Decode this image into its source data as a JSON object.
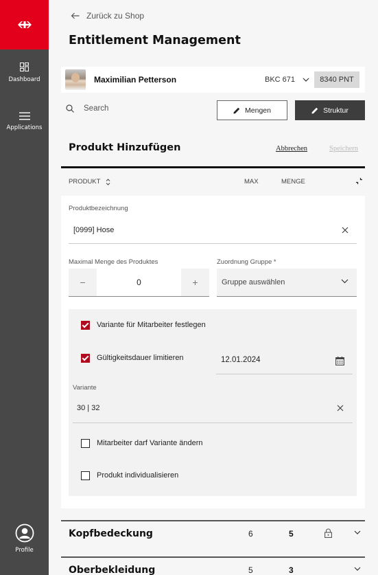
{
  "sidebar": {
    "logo": "sbb-logo-icon",
    "items": [
      {
        "label": "Dashboard",
        "icon": "dashboard-icon"
      },
      {
        "label": "Applications",
        "icon": "menu-icon"
      }
    ],
    "profile": {
      "label": "Profile",
      "icon": "profile-icon"
    }
  },
  "header": {
    "back_label": "Zurück zu Shop",
    "title": "Entitlement Management"
  },
  "user": {
    "name": "Maximilian Petterson",
    "account": "BKC 671",
    "points": "8340 PNT"
  },
  "toolbar": {
    "search_placeholder": "Search",
    "mengen_label": "Mengen",
    "struktur_label": "Struktur"
  },
  "section": {
    "title": "Produkt Hinzufügen",
    "cancel_label": "Abbrechen",
    "save_label": "Speichern"
  },
  "table_header": {
    "produkt": "PRODUKT",
    "max": "MAX",
    "menge": "MENGE"
  },
  "form": {
    "product_label": "Produktbezeichnung",
    "product_value": "[0999]  Hose",
    "max_qty_label": "Maximal Menge des Produktes",
    "max_qty_value": "0",
    "group_label": "Zuordnung Gruppe *",
    "group_placeholder": "Gruppe auswählen",
    "variant_fix_label": "Variante für Mitarbeiter festlegen",
    "variant_fix_checked": true,
    "validity_label": "Gültigkeitsdauer limitieren",
    "validity_checked": true,
    "validity_date": "12.01.2024",
    "variant_label": "Variante",
    "variant_value": "30 | 32",
    "employee_change_label": "Mitarbeiter darf Variante ändern",
    "employee_change_checked": false,
    "individualize_label": "Produkt  individualisieren",
    "individualize_checked": false
  },
  "categories": [
    {
      "name": "Kopfbedeckung",
      "max": "6",
      "menge": "5",
      "locked": true
    },
    {
      "name": "Oberbekleidung",
      "max": "5",
      "menge": "3",
      "locked": false
    }
  ],
  "colors": {
    "brand_red": "#e2001a",
    "sidebar": "#484848",
    "checkbox_red": "#b00a1f",
    "dark_button": "#3d3d3d"
  }
}
